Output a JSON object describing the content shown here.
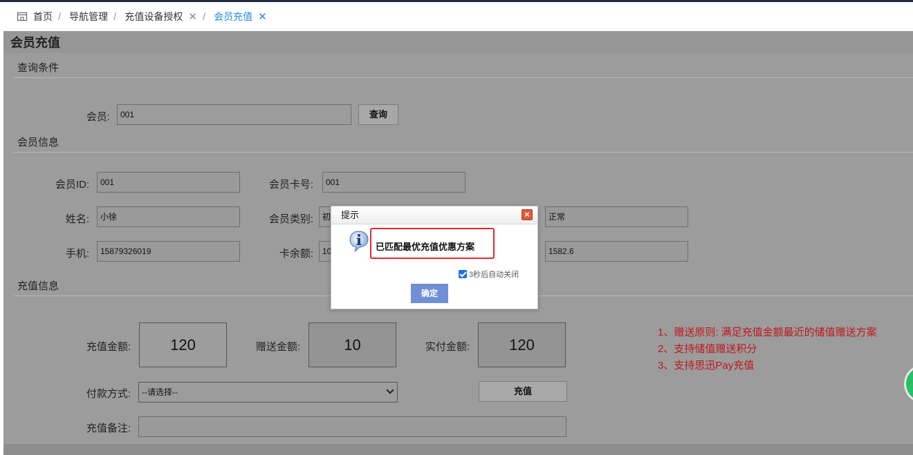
{
  "breadcrumb": {
    "home": "首页",
    "items": [
      "导航管理",
      "充值设备授权"
    ],
    "active": "会员充值"
  },
  "panel": {
    "title": "会员充值"
  },
  "query": {
    "section": "查询条件",
    "member_label": "会员:",
    "member_value": "001",
    "search_button": "查询"
  },
  "member_info": {
    "section": "会员信息",
    "id_label": "会员ID:",
    "id_value": "001",
    "card_label": "会员卡号:",
    "card_value": "001",
    "name_label": "姓名:",
    "name_value": "小徐",
    "type_label": "会员类别:",
    "type_value": "初",
    "status_value": "正常",
    "phone_label": "手机:",
    "phone_value": "15879326019",
    "balance_label": "卡余额:",
    "balance_value": "10",
    "points_value": "1582.6"
  },
  "recharge": {
    "section": "充值信息",
    "amount_label": "充值金额:",
    "amount_value": "120",
    "bonus_label": "赠送金额:",
    "bonus_value": "10",
    "paid_label": "实付金额:",
    "paid_value": "120",
    "payment_label": "付款方式:",
    "payment_selected": "--请选择--",
    "recharge_button": "充值",
    "remark_label": "充值备注:",
    "remark_value": ""
  },
  "notes": [
    "1、赠送原则: 满足充值金额最近的储值赠送方案",
    "2、支持储值赠送积分",
    "3、支持思迅Pay充值"
  ],
  "dialog": {
    "title": "提示",
    "close": "×",
    "message": "已匹配最优充值优惠方案",
    "auto_close": "3秒后自动关闭",
    "auto_close_checked": true,
    "ok": "确定"
  },
  "colors": {
    "accent": "#1e88e5",
    "note_red": "#c0161b",
    "highlight": "#e8252b",
    "ok_button": "#6f8fd6"
  }
}
